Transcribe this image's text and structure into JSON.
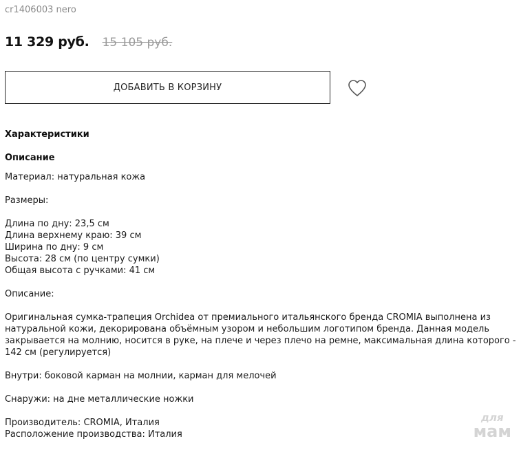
{
  "product": {
    "sku": "cr1406003 nero",
    "price_current": "11 329 руб.",
    "price_old": "15 105 руб."
  },
  "actions": {
    "add_to_cart_label": "ДОБАВИТЬ В КОРЗИНУ",
    "favorite_icon": "heart-outline-icon"
  },
  "sections": {
    "characteristics_title": "Характеристики",
    "description_title": "Описание"
  },
  "description": {
    "material": "Материал: натуральная кожа",
    "sizes_label": "Размеры:",
    "sizes": [
      "Длина по дну: 23,5 см",
      "Длина верхнему краю: 39 см",
      "Ширина по дну: 9 см",
      "Высота: 28 см (по центру сумки)",
      "Общая высота с ручками: 41 см"
    ],
    "description_label": "Описание:",
    "text_lines": [
      "Оригинальная сумка-трапеция Orchidea от премиального итальянского бренда CROMIA выполнена из",
      "натуральной кожи, декорирована объёмным узором и небольшим логотипом бренда. Данная модель",
      "закрывается на молнию, носится в руке, на плече и через плечо на ремне, максимальная длина которого -",
      "142 см (регулируется)"
    ],
    "inside": "Внутри: боковой карман на молнии, карман для мелочей",
    "outside": "Снаружи: на дне металлические ножки",
    "manufacturer": "Производитель: CROMIA, Италия",
    "production_location": "Расположение производства: Италия"
  },
  "watermark": {
    "top": "для",
    "bottom": "мам"
  }
}
